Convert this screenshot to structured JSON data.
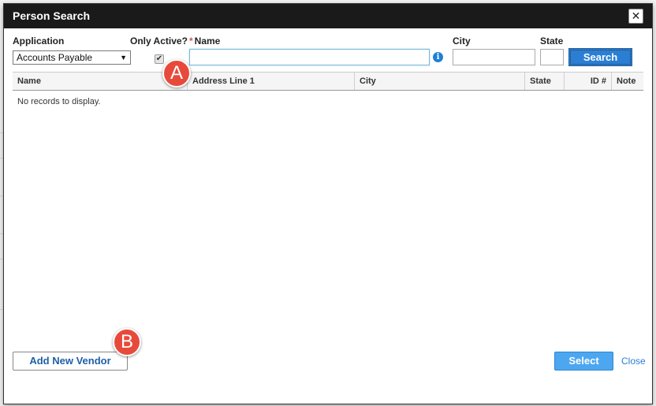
{
  "dialog": {
    "title": "Person Search",
    "close_glyph": "✕"
  },
  "filters": {
    "application_label": "Application",
    "application_value": "Accounts Payable",
    "only_active_label": "Only Active?",
    "only_active_checked": true,
    "name_required_mark": "*",
    "name_label": "Name",
    "name_value": "",
    "city_label": "City",
    "city_value": "",
    "state_label": "State",
    "state_value": "",
    "search_button": "Search"
  },
  "grid": {
    "columns": [
      "Name",
      "Address Line 1",
      "City",
      "State",
      "ID #",
      "Note"
    ],
    "empty_message": "No records to display."
  },
  "footer": {
    "add_vendor_button": "Add New Vendor",
    "select_button": "Select",
    "close_link": "Close"
  },
  "annotations": {
    "marker_a": "A",
    "marker_b": "B"
  },
  "icons": {
    "info": "info-icon",
    "checkbox": "check-icon",
    "dropdown": "chevron-down-icon",
    "close": "close-icon"
  },
  "colors": {
    "titlebar": "#1a1a1a",
    "primary_button": "#2a7fd4",
    "select_button": "#4da6f0",
    "marker": "#e74a3b"
  }
}
